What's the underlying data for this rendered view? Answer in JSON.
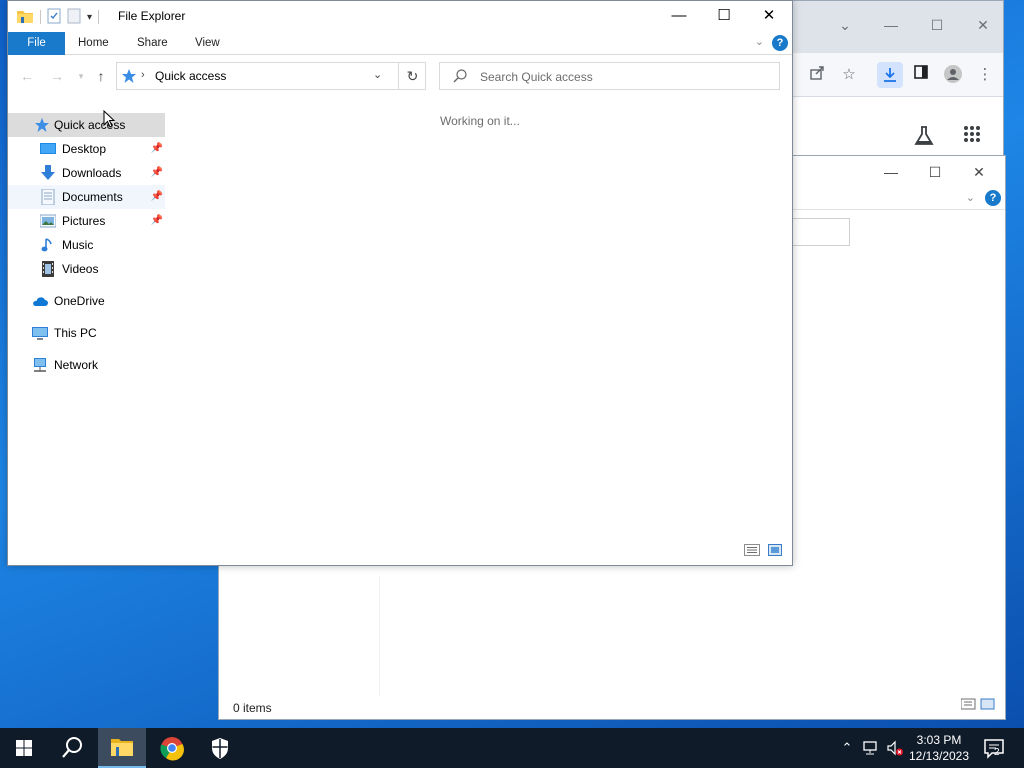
{
  "explorer": {
    "title": "File Explorer",
    "ribbon_tabs": [
      "File",
      "Home",
      "Share",
      "View"
    ],
    "address": {
      "location": "Quick access"
    },
    "search": {
      "placeholder": "Search Quick access"
    },
    "status_message": "Working on it...",
    "nav_tree": {
      "quick_access": "Quick access",
      "pinned": [
        {
          "label": "Desktop",
          "icon": "desktop-folder-icon",
          "pinned": true
        },
        {
          "label": "Downloads",
          "icon": "downloads-folder-icon",
          "pinned": true
        },
        {
          "label": "Documents",
          "icon": "documents-folder-icon",
          "pinned": true
        },
        {
          "label": "Pictures",
          "icon": "pictures-folder-icon",
          "pinned": true
        },
        {
          "label": "Music",
          "icon": "music-folder-icon",
          "pinned": false
        },
        {
          "label": "Videos",
          "icon": "videos-folder-icon",
          "pinned": false
        }
      ],
      "onedrive": "OneDrive",
      "this_pc": "This PC",
      "network": "Network"
    }
  },
  "background_explorer": {
    "status": "0 items"
  },
  "taskbar": {
    "time": "3:03 PM",
    "date": "12/13/2023",
    "notification_count": "2"
  },
  "colors": {
    "ribbon_file_tab": "#1979ca",
    "selection": "#dcdcdc",
    "taskbar": "#101b2a",
    "desktop": "#1e86e6"
  }
}
